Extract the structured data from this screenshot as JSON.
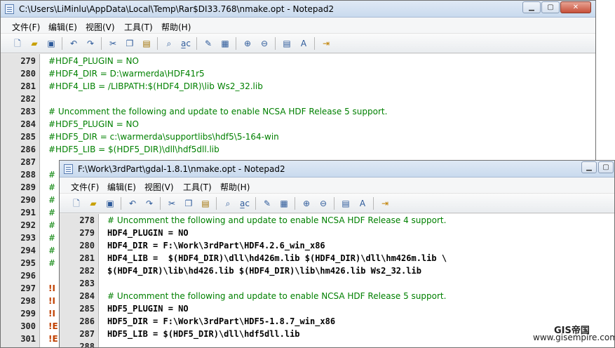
{
  "window1": {
    "title": "C:\\Users\\LiMinlu\\AppData\\Local\\Temp\\Rar$DI33.768\\nmake.opt - Notepad2",
    "menu": [
      "文件(F)",
      "编辑(E)",
      "视图(V)",
      "工具(T)",
      "帮助(H)"
    ],
    "lines": [
      {
        "n": "279",
        "text": "#HDF4_PLUGIN = NO",
        "style": "cm"
      },
      {
        "n": "280",
        "text": "#HDF4_DIR = D:\\warmerda\\HDF41r5",
        "style": "cm"
      },
      {
        "n": "281",
        "text": "#HDF4_LIB = /LIBPATH:$(HDF4_DIR)\\lib Ws2_32.lib",
        "style": "cm"
      },
      {
        "n": "282",
        "text": "",
        "style": "cm"
      },
      {
        "n": "283",
        "text": "# Uncomment the following and update to enable NCSA HDF Release 5 support.",
        "style": "cm"
      },
      {
        "n": "284",
        "text": "#HDF5_PLUGIN = NO",
        "style": "cm"
      },
      {
        "n": "285",
        "text": "#HDF5_DIR = c:\\warmerda\\supportlibs\\hdf5\\5-164-win",
        "style": "cm"
      },
      {
        "n": "286",
        "text": "#HDF5_LIB = $(HDF5_DIR)\\dll\\hdf5dll.lib",
        "style": "cm"
      },
      {
        "n": "287",
        "text": "",
        "style": "cm"
      },
      {
        "n": "288",
        "text": "#",
        "style": "cm"
      },
      {
        "n": "289",
        "text": "#",
        "style": "cm"
      },
      {
        "n": "290",
        "text": "#",
        "style": "cm"
      },
      {
        "n": "291",
        "text": "#",
        "style": "cm"
      },
      {
        "n": "292",
        "text": "#",
        "style": "cm"
      },
      {
        "n": "293",
        "text": "#",
        "style": "cm"
      },
      {
        "n": "294",
        "text": "#",
        "style": "cm"
      },
      {
        "n": "295",
        "text": "#",
        "style": "cm"
      },
      {
        "n": "296",
        "text": "",
        "style": "cm"
      },
      {
        "n": "297",
        "text": "!I",
        "style": "kw"
      },
      {
        "n": "298",
        "text": "!I",
        "style": "kw"
      },
      {
        "n": "299",
        "text": "!I",
        "style": "kw"
      },
      {
        "n": "300",
        "text": "!E",
        "style": "kw"
      },
      {
        "n": "301",
        "text": "!E",
        "style": "kw"
      }
    ]
  },
  "window2": {
    "title": "F:\\Work\\3rdPart\\gdal-1.8.1\\nmake.opt - Notepad2",
    "menu": [
      "文件(F)",
      "编辑(E)",
      "视图(V)",
      "工具(T)",
      "帮助(H)"
    ],
    "lines": [
      {
        "n": "278",
        "text": "# Uncomment the following and update to enable NCSA HDF Release 4 support.",
        "style": "cm"
      },
      {
        "n": "279",
        "text": "HDF4_PLUGIN = NO",
        "style": "mono"
      },
      {
        "n": "280",
        "text": "HDF4_DIR = F:\\Work\\3rdPart\\HDF4.2.6_win_x86",
        "style": "mono"
      },
      {
        "n": "281",
        "text": "HDF4_LIB =  $(HDF4_DIR)\\dll\\hd426m.lib $(HDF4_DIR)\\dll\\hm426m.lib \\",
        "style": "mono"
      },
      {
        "n": "282",
        "text": "$(HDF4_DIR)\\lib\\hd426.lib $(HDF4_DIR)\\lib\\hm426.lib Ws2_32.lib",
        "style": "mono"
      },
      {
        "n": "283",
        "text": "",
        "style": "mono"
      },
      {
        "n": "284",
        "text": "# Uncomment the following and update to enable NCSA HDF Release 5 support.",
        "style": "cm"
      },
      {
        "n": "285",
        "text": "HDF5_PLUGIN = NO",
        "style": "mono"
      },
      {
        "n": "286",
        "text": "HDF5_DIR = F:\\Work\\3rdPart\\HDF5-1.8.7_win_x86",
        "style": "mono"
      },
      {
        "n": "287",
        "text": "HDF5_LIB = $(HDF5_DIR)\\dll\\hdf5dll.lib",
        "style": "mono"
      },
      {
        "n": "288",
        "text": "",
        "style": "mono"
      }
    ]
  },
  "watermark": {
    "brand": "GIS帝国",
    "url": "www.gisempire.com"
  },
  "side_fragment": "ort"
}
